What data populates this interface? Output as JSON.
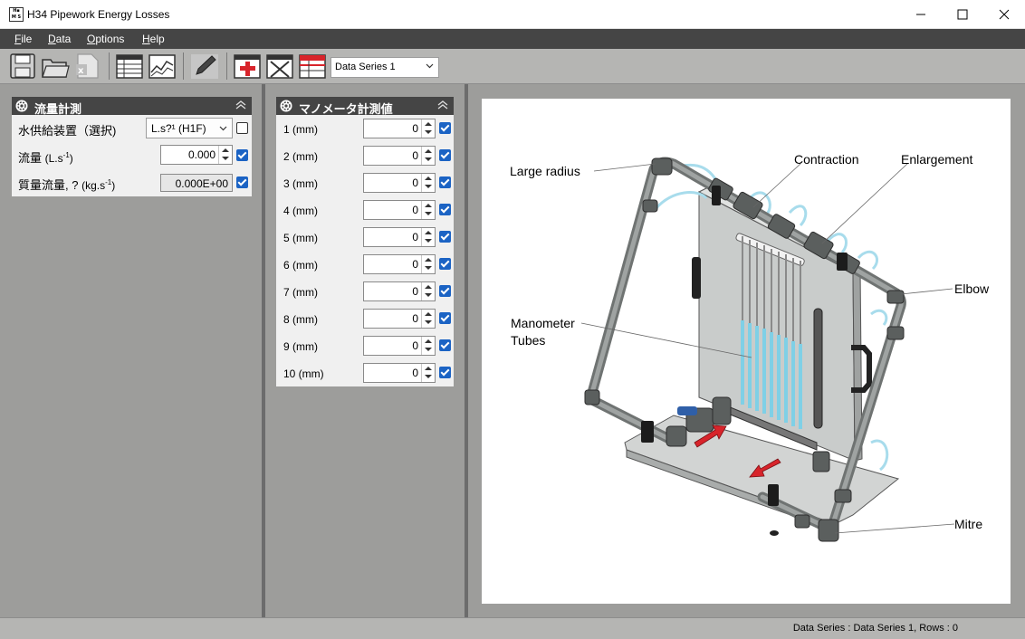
{
  "window": {
    "title": "H34 Pipework Energy Losses",
    "icon_letters": "HDMS"
  },
  "menu": [
    {
      "label": "File"
    },
    {
      "label": "Data"
    },
    {
      "label": "Options"
    },
    {
      "label": "Help"
    }
  ],
  "toolbar": {
    "icons": [
      "save-icon",
      "open-folder-icon",
      "excel-export-icon",
      "table-view-icon",
      "chart-view-icon",
      "edit-pencil-icon",
      "add-row-icon",
      "delete-row-icon",
      "series-table-icon"
    ],
    "series_select": "Data Series 1"
  },
  "flow_panel": {
    "title": "流量計測",
    "supply_label": "水供給装置（選択)",
    "supply_value": "L.s?¹ (H1F)",
    "supply_checked": false,
    "flow_label": "流量",
    "flow_unit_base": "(L.s",
    "flow_unit_exp": "-1",
    "flow_unit_close": ")",
    "flow_value": "0.000",
    "flow_checked": true,
    "mass_label": "質量流量, ?",
    "mass_unit_base": "(kg.s",
    "mass_unit_exp": "-1",
    "mass_unit_close": ")",
    "mass_value": "0.000E+00",
    "mass_checked": true
  },
  "manometer_panel": {
    "title": "マノメータ計測値",
    "rows": [
      {
        "label": "1  (mm)",
        "value": "0",
        "checked": true
      },
      {
        "label": "2  (mm)",
        "value": "0",
        "checked": true
      },
      {
        "label": "3  (mm)",
        "value": "0",
        "checked": true
      },
      {
        "label": "4  (mm)",
        "value": "0",
        "checked": true
      },
      {
        "label": "5  (mm)",
        "value": "0",
        "checked": true
      },
      {
        "label": "6  (mm)",
        "value": "0",
        "checked": true
      },
      {
        "label": "7  (mm)",
        "value": "0",
        "checked": true
      },
      {
        "label": "8  (mm)",
        "value": "0",
        "checked": true
      },
      {
        "label": "9  (mm)",
        "value": "0",
        "checked": true
      },
      {
        "label": "10  (mm)",
        "value": "0",
        "checked": true
      }
    ]
  },
  "diagram": {
    "labels": {
      "large_radius": "Large radius",
      "contraction": "Contraction",
      "enlargement": "Enlargement",
      "elbow": "Elbow",
      "manometer_line1": "Manometer",
      "manometer_line2": "Tubes",
      "mitre": "Mitre"
    }
  },
  "status": {
    "text": "Data Series : Data Series 1,  Rows : 0"
  },
  "colors": {
    "menu_bg": "#454545",
    "toolbar_bg": "#b5b5b3",
    "checkbox_blue": "#1b63c4",
    "water": "#7fd0e6",
    "arrow_red": "#d8242b"
  }
}
